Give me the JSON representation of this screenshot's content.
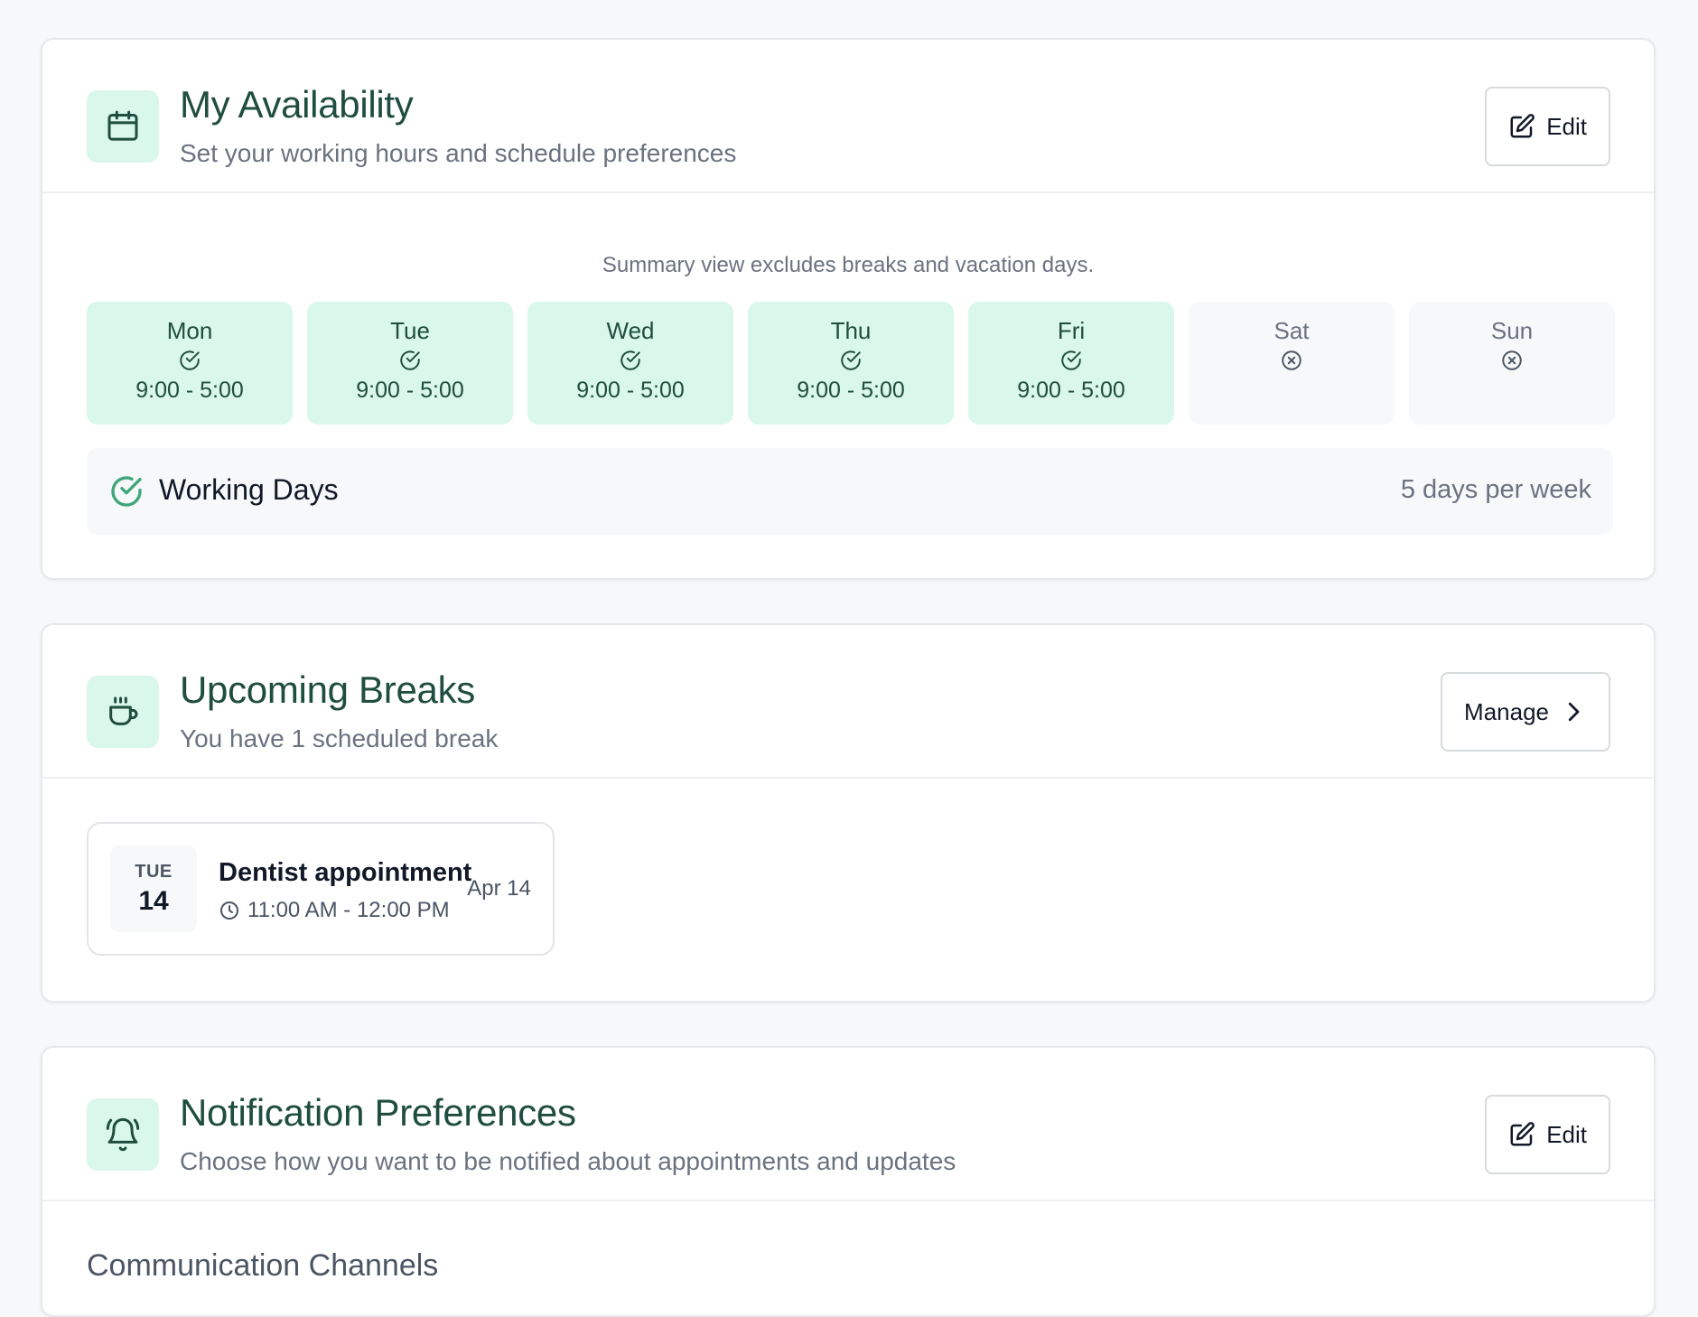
{
  "availability": {
    "title": "My Availability",
    "subtitle": "Set your working hours and schedule preferences",
    "edit_label": "Edit",
    "icon": "calendar-icon",
    "summary_note": "Summary view excludes breaks and vacation days.",
    "days": [
      {
        "name": "Mon",
        "hours": "9:00 - 5:00",
        "active": true
      },
      {
        "name": "Tue",
        "hours": "9:00 - 5:00",
        "active": true
      },
      {
        "name": "Wed",
        "hours": "9:00 - 5:00",
        "active": true
      },
      {
        "name": "Thu",
        "hours": "9:00 - 5:00",
        "active": true
      },
      {
        "name": "Fri",
        "hours": "9:00 - 5:00",
        "active": true
      },
      {
        "name": "Sat",
        "hours": "",
        "active": false
      },
      {
        "name": "Sun",
        "hours": "",
        "active": false
      }
    ],
    "working_days_label": "Working Days",
    "working_days_value": "5 days per week"
  },
  "breaks": {
    "title": "Upcoming Breaks",
    "subtitle": "You have 1 scheduled break",
    "manage_label": "Manage",
    "icon": "coffee-cup-icon",
    "items": [
      {
        "dow": "TUE",
        "day": "14",
        "title": "Dentist appointment",
        "time": "11:00 AM - 12:00 PM",
        "date": "Apr 14"
      }
    ]
  },
  "notifications": {
    "title": "Notification Preferences",
    "subtitle": "Choose how you want to be notified about appointments and updates",
    "edit_label": "Edit",
    "icon": "bell-icon",
    "section_label": "Communication Channels"
  },
  "colors": {
    "accent_bg": "#d9f7ea",
    "accent_text": "#1f4d3f",
    "check_green": "#3fa77a"
  }
}
